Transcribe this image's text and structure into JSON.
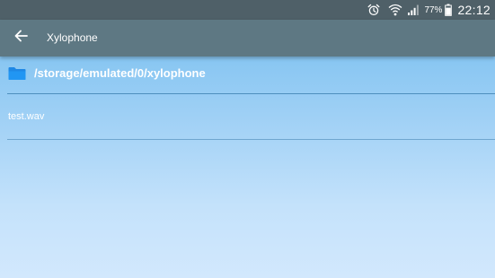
{
  "status_bar": {
    "battery_percent": "77%",
    "time": "22:12",
    "icons": [
      "alarm-icon",
      "wifi-icon",
      "signal-icon",
      "battery-icon"
    ]
  },
  "app_bar": {
    "back_icon": "arrow-back-icon",
    "title": "Xylophone"
  },
  "directory": {
    "folder_icon": "folder-icon",
    "folder_color": "#1e88e5",
    "path": "/storage/emulated/0/xylophone"
  },
  "files": [
    {
      "name": "test.wav"
    }
  ]
}
